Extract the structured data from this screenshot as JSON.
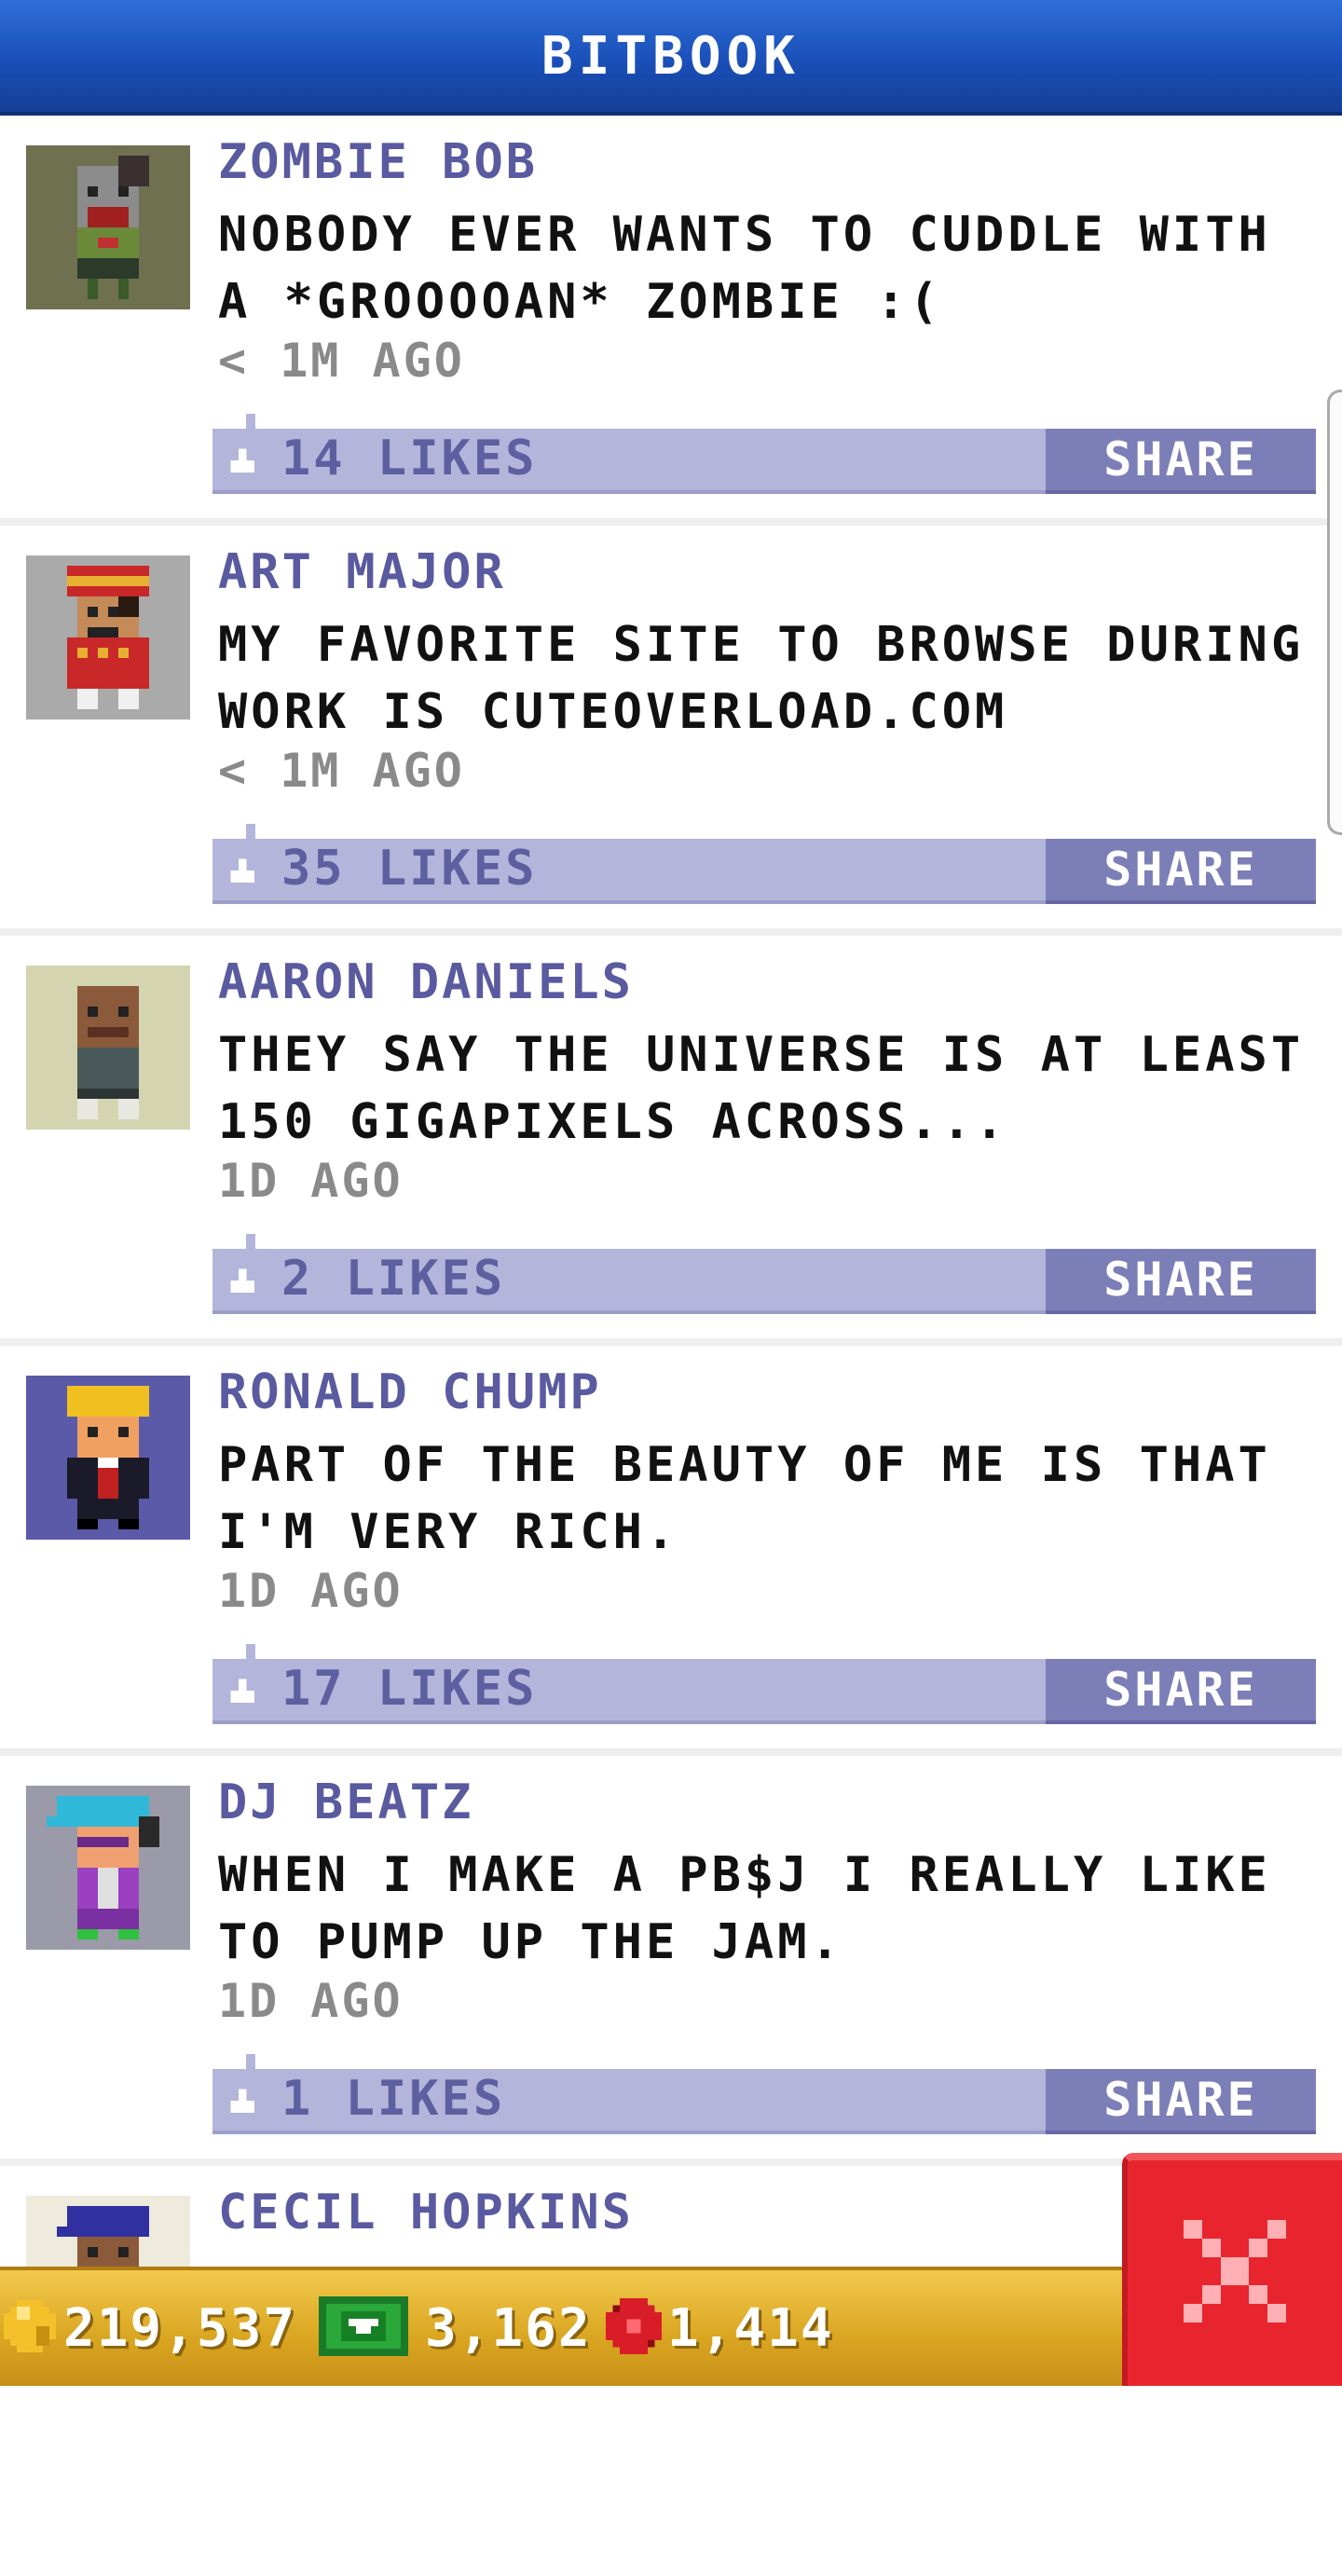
{
  "header": {
    "title": "BITBOOK"
  },
  "posts": [
    {
      "author": "ZOMBIE BOB",
      "message": "NOBODY EVER WANTS TO CUDDLE WITH A *GROOOOAN* ZOMBIE :(",
      "time": "< 1M AGO",
      "likes": "14 LIKES",
      "share": "SHARE",
      "avatar_bg": "#6e7050"
    },
    {
      "author": "ART MAJOR",
      "message": "MY FAVORITE SITE TO BROWSE DURING WORK IS CUTEOVERLOAD.COM",
      "time": "< 1M AGO",
      "likes": "35 LIKES",
      "share": "SHARE",
      "avatar_bg": "#aaaaaa"
    },
    {
      "author": "AARON DANIELS",
      "message": "THEY SAY THE UNIVERSE IS AT LEAST 150 GIGAPIXELS ACROSS...",
      "time": "1D AGO",
      "likes": "2 LIKES",
      "share": "SHARE",
      "avatar_bg": "#d4d4b0"
    },
    {
      "author": "RONALD CHUMP",
      "message": "PART OF THE BEAUTY OF ME IS THAT I'M VERY RICH.",
      "time": "1D AGO",
      "likes": "17 LIKES",
      "share": "SHARE",
      "avatar_bg": "#5a5aa8"
    },
    {
      "author": "DJ BEATZ",
      "message": "WHEN I MAKE A PB$J I REALLY LIKE TO PUMP UP THE JAM.",
      "time": "1D AGO",
      "likes": "1 LIKES",
      "share": "SHARE",
      "avatar_bg": "#9a9aa8"
    },
    {
      "author": "CECIL HOPKINS",
      "avatar_bg": "#eeeadc"
    }
  ],
  "currency": {
    "coins": "219,537",
    "bux": "3,162",
    "tokens": "1,414"
  },
  "icons": {
    "coin": "coin-icon",
    "bux": "bux-icon",
    "token": "token-icon",
    "like": "thumbs-up-icon",
    "close": "close-icon"
  },
  "colors": {
    "header": "#1a4fb8",
    "author": "#5a5aa0",
    "like_bar": "#b3b5da",
    "share_button": "#7c7eb8",
    "close_button": "#e8252e",
    "currency_bar": "#d9a520"
  }
}
